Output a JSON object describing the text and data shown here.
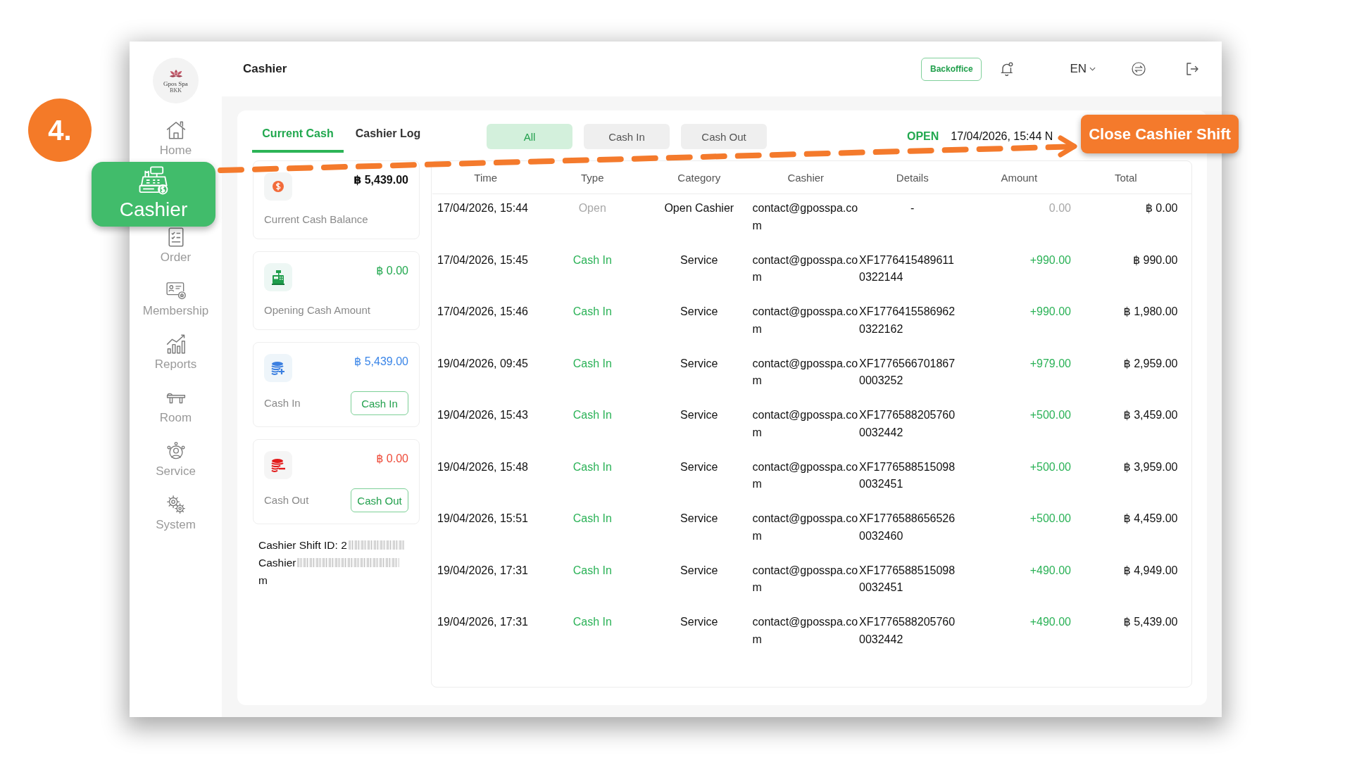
{
  "annotation": {
    "step": "4."
  },
  "sidebar": {
    "logo": {
      "name": "Gpos Spa",
      "branch": "BKK"
    },
    "items": [
      {
        "label": "Home",
        "selected": false
      },
      {
        "label": "Cashier",
        "selected": true
      },
      {
        "label": "Order",
        "selected": false
      },
      {
        "label": "Membership",
        "selected": false
      },
      {
        "label": "Reports",
        "selected": false
      },
      {
        "label": "Room",
        "selected": false
      },
      {
        "label": "Service",
        "selected": false
      },
      {
        "label": "System",
        "selected": false
      }
    ]
  },
  "header": {
    "title": "Cashier",
    "backoffice_button": "Backoffice",
    "language": "EN"
  },
  "tabs": [
    {
      "label": "Current Cash",
      "selected": true
    },
    {
      "label": "Cashier Log",
      "selected": false
    }
  ],
  "filters": [
    {
      "label": "All",
      "selected": true
    },
    {
      "label": "Cash In",
      "selected": false
    },
    {
      "label": "Cash Out",
      "selected": false
    }
  ],
  "shift_status": {
    "state": "OPEN",
    "opened_at": "17/04/2026, 15:44 N"
  },
  "close_shift_button": "Close Cashier Shift",
  "cards": [
    {
      "kind": "balance",
      "amount": "฿ 5,439.00",
      "label": "Current Cash Balance"
    },
    {
      "kind": "opening",
      "amount": "฿ 0.00",
      "label": "Opening Cash Amount"
    },
    {
      "kind": "cash_in",
      "amount": "฿ 5,439.00",
      "label": "Cash In",
      "button": "Cash In"
    },
    {
      "kind": "cash_out",
      "amount": "฿ 0.00",
      "label": "Cash Out",
      "button": "Cash Out"
    }
  ],
  "shift_info": [
    {
      "text": "Cashier Shift ID: 2",
      "redacted": true
    },
    {
      "text": "Cashier",
      "redacted": true
    },
    {
      "text": "m",
      "redacted": false
    }
  ],
  "table": {
    "columns": [
      "Time",
      "Type",
      "Category",
      "Cashier",
      "Details",
      "Amount",
      "Total"
    ],
    "rows": [
      {
        "kind": "open",
        "time": "17/04/2026, 15:44",
        "type": "Open",
        "category": "Open Cashier",
        "cashier": "contact@gposspa.com",
        "details": "-",
        "amount": "0.00",
        "total": "฿ 0.00"
      },
      {
        "kind": "cash_in",
        "time": "17/04/2026, 15:45",
        "type": "Cash In",
        "category": "Service",
        "cashier": "contact@gposspa.com",
        "details": "XF17764154896110322144",
        "amount": "+990.00",
        "total": "฿ 990.00"
      },
      {
        "kind": "cash_in",
        "time": "17/04/2026, 15:46",
        "type": "Cash In",
        "category": "Service",
        "cashier": "contact@gposspa.com",
        "details": "XF17764155869620322162",
        "amount": "+990.00",
        "total": "฿ 1,980.00"
      },
      {
        "kind": "cash_in",
        "time": "19/04/2026, 09:45",
        "type": "Cash In",
        "category": "Service",
        "cashier": "contact@gposspa.com",
        "details": "XF17765667018670003252",
        "amount": "+979.00",
        "total": "฿ 2,959.00"
      },
      {
        "kind": "cash_in",
        "time": "19/04/2026, 15:43",
        "type": "Cash In",
        "category": "Service",
        "cashier": "contact@gposspa.com",
        "details": "XF17765882057600032442",
        "amount": "+500.00",
        "total": "฿ 3,459.00"
      },
      {
        "kind": "cash_in",
        "time": "19/04/2026, 15:48",
        "type": "Cash In",
        "category": "Service",
        "cashier": "contact@gposspa.com",
        "details": "XF17765885150980032451",
        "amount": "+500.00",
        "total": "฿ 3,959.00"
      },
      {
        "kind": "cash_in",
        "time": "19/04/2026, 15:51",
        "type": "Cash In",
        "category": "Service",
        "cashier": "contact@gposspa.com",
        "details": "XF17765886565260032460",
        "amount": "+500.00",
        "total": "฿ 4,459.00"
      },
      {
        "kind": "cash_in",
        "time": "19/04/2026, 17:31",
        "type": "Cash In",
        "category": "Service",
        "cashier": "contact@gposspa.com",
        "details": "XF17765885150980032451",
        "amount": "+490.00",
        "total": "฿ 4,949.00"
      },
      {
        "kind": "cash_in",
        "time": "19/04/2026, 17:31",
        "type": "Cash In",
        "category": "Service",
        "cashier": "contact@gposspa.com",
        "details": "XF17765882057600032442",
        "amount": "+490.00",
        "total": "฿ 5,439.00"
      }
    ]
  }
}
